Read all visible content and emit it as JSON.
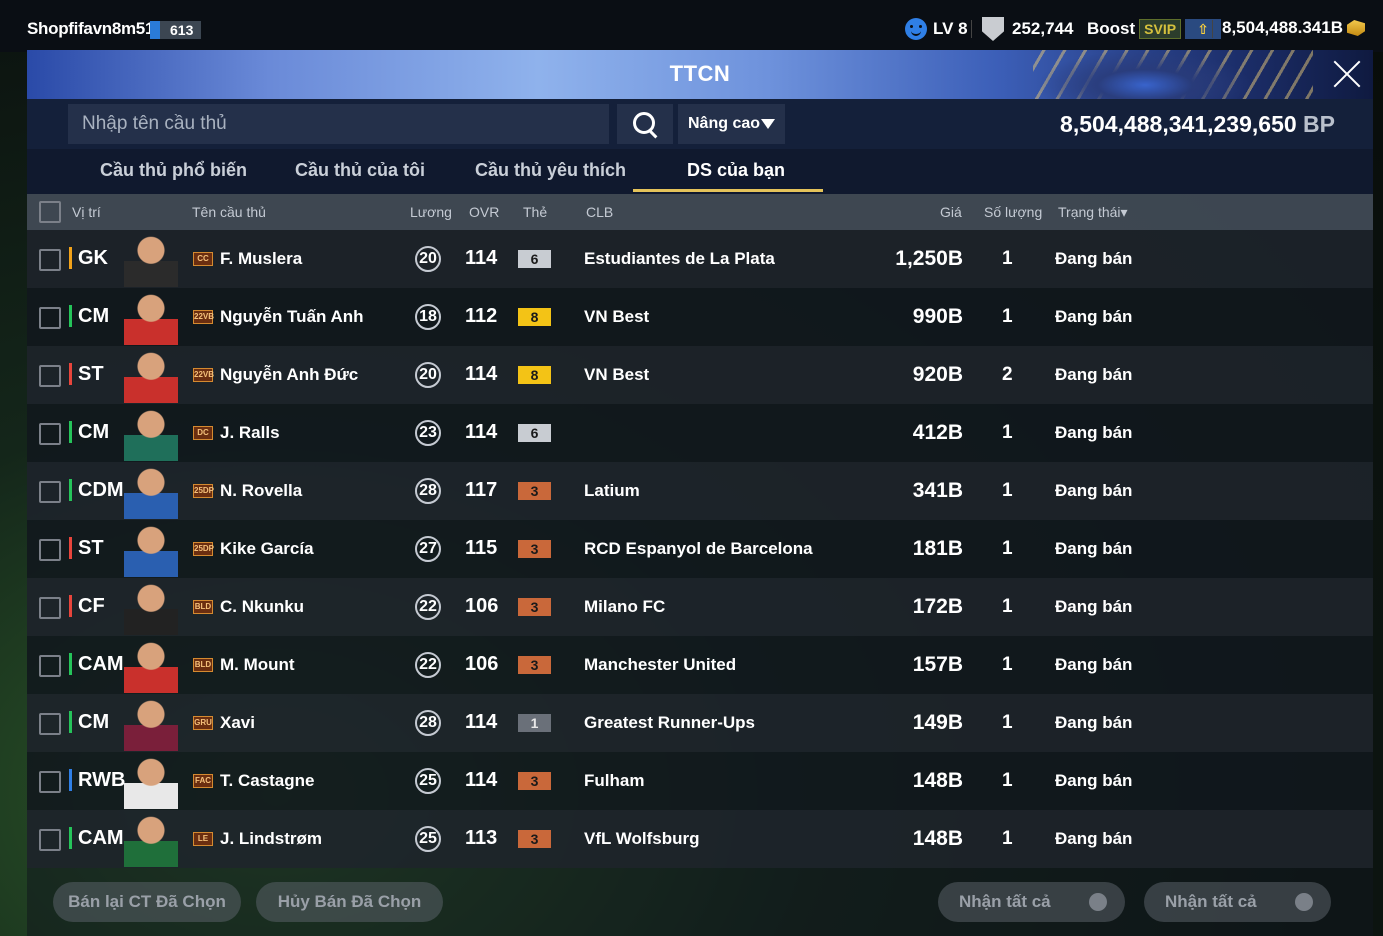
{
  "topbar": {
    "username": "Shopfifavn8m51",
    "user_badge": "613",
    "level": "LV 8",
    "coins": "252,744",
    "boost_label": "Boost",
    "svip_label": "SVIP",
    "bp_balance": "8,504,488.341B"
  },
  "header": {
    "title": "TTCN"
  },
  "search": {
    "placeholder": "Nhập tên cầu thủ",
    "advanced_label": "Nâng cao",
    "bp_total": "8,504,488,341,239,650",
    "bp_unit": "BP"
  },
  "tabs": [
    {
      "label": "Cầu thủ phổ biến",
      "active": false
    },
    {
      "label": "Cầu thủ của tôi",
      "active": false
    },
    {
      "label": "Cầu thủ yêu thích",
      "active": false
    },
    {
      "label": "DS của bạn",
      "active": true
    }
  ],
  "columns": {
    "position": "Vị trí",
    "name": "Tên cầu thủ",
    "salary": "Lương",
    "ovr": "OVR",
    "upgrade": "Thẻ",
    "club": "CLB",
    "price": "Giá",
    "quantity": "Số lượng",
    "status": "Trạng thái▾"
  },
  "players": [
    {
      "position": "GK",
      "pos_color": "gk",
      "season": "CC",
      "name": "F. Muslera",
      "salary": "20",
      "ovr": "114",
      "upgrade": "6",
      "upgrade_tier": "silver",
      "club": "Estudiantes de La Plata",
      "price": "1,250B",
      "quantity": "1",
      "status": "Đang bán"
    },
    {
      "position": "CM",
      "pos_color": "mid",
      "season": "22VB",
      "name": "Nguyễn Tuấn Anh",
      "salary": "18",
      "ovr": "112",
      "upgrade": "8",
      "upgrade_tier": "gold",
      "club": "VN Best",
      "price": "990B",
      "quantity": "1",
      "status": "Đang bán"
    },
    {
      "position": "ST",
      "pos_color": "fwd",
      "season": "22VB",
      "name": "Nguyễn Anh Đức",
      "salary": "20",
      "ovr": "114",
      "upgrade": "8",
      "upgrade_tier": "gold",
      "club": "VN Best",
      "price": "920B",
      "quantity": "2",
      "status": "Đang bán"
    },
    {
      "position": "CM",
      "pos_color": "mid",
      "season": "DC",
      "name": "J. Ralls",
      "salary": "23",
      "ovr": "114",
      "upgrade": "6",
      "upgrade_tier": "silver",
      "club": "",
      "price": "412B",
      "quantity": "1",
      "status": "Đang bán"
    },
    {
      "position": "CDM",
      "pos_color": "mid",
      "season": "25DP",
      "name": "N. Rovella",
      "salary": "28",
      "ovr": "117",
      "upgrade": "3",
      "upgrade_tier": "bronze",
      "club": "Latium",
      "price": "341B",
      "quantity": "1",
      "status": "Đang bán"
    },
    {
      "position": "ST",
      "pos_color": "fwd",
      "season": "25DP",
      "name": "Kike García",
      "salary": "27",
      "ovr": "115",
      "upgrade": "3",
      "upgrade_tier": "bronze",
      "club": "RCD Espanyol de Barcelona",
      "price": "181B",
      "quantity": "1",
      "status": "Đang bán"
    },
    {
      "position": "CF",
      "pos_color": "fwd",
      "season": "BLD",
      "name": "C. Nkunku",
      "salary": "22",
      "ovr": "106",
      "upgrade": "3",
      "upgrade_tier": "bronze",
      "club": "Milano FC",
      "price": "172B",
      "quantity": "1",
      "status": "Đang bán"
    },
    {
      "position": "CAM",
      "pos_color": "mid",
      "season": "BLD",
      "name": "M. Mount",
      "salary": "22",
      "ovr": "106",
      "upgrade": "3",
      "upgrade_tier": "bronze",
      "club": "Manchester United",
      "price": "157B",
      "quantity": "1",
      "status": "Đang bán"
    },
    {
      "position": "CM",
      "pos_color": "mid",
      "season": "GRU",
      "name": "Xavi",
      "salary": "28",
      "ovr": "114",
      "upgrade": "1",
      "upgrade_tier": "gray",
      "club": "Greatest Runner-Ups",
      "price": "149B",
      "quantity": "1",
      "status": "Đang bán"
    },
    {
      "position": "RWB",
      "pos_color": "def",
      "season": "FAC",
      "name": "T. Castagne",
      "salary": "25",
      "ovr": "114",
      "upgrade": "3",
      "upgrade_tier": "bronze",
      "club": "Fulham",
      "price": "148B",
      "quantity": "1",
      "status": "Đang bán"
    },
    {
      "position": "CAM",
      "pos_color": "mid",
      "season": "LE",
      "name": "J. Lindstrøm",
      "salary": "25",
      "ovr": "113",
      "upgrade": "3",
      "upgrade_tier": "bronze",
      "club": "VfL Wolfsburg",
      "price": "148B",
      "quantity": "1",
      "status": "Đang bán"
    }
  ],
  "footer": {
    "resell_label": "Bán lại CT Đã Chọn",
    "cancel_label": "Hủy Bán Đã Chọn",
    "claim_all_1": "Nhận tất cả",
    "claim_all_2": "Nhận tất cả"
  }
}
